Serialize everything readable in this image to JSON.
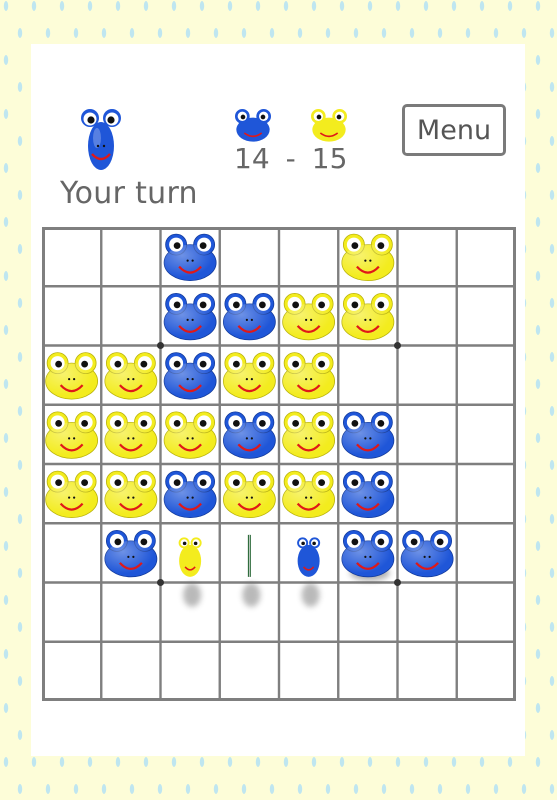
{
  "colors": {
    "background": "#fdfdd8",
    "raindrop": "#bfe6f0",
    "card": "#ffffff",
    "grid_line": "#7f7f7f",
    "blue_frog": "#1f56d8",
    "yellow_frog": "#f3ec1e",
    "text": "#666666"
  },
  "status": {
    "turn_label": "Your turn",
    "current_player": "blue"
  },
  "score": {
    "blue": "14",
    "separator": "-",
    "yellow": "15"
  },
  "menu": {
    "label": "Menu"
  },
  "board": {
    "rows": 8,
    "cols": 8,
    "legend": "B = blue frog, Y = yellow frog, . = empty",
    "cells": [
      ". . B . . Y . .",
      ". . B B Y Y . .",
      "Y Y B Y Y . . .",
      "Y Y Y B Y B . .",
      "Y Y B Y Y B . .",
      ". B . . . B B .",
      ". . . . . . . .",
      ". . . . . . . ."
    ],
    "flipping": [
      {
        "row": 5,
        "col": 2,
        "from": "yellow",
        "to": "blue",
        "stage": "yellow-edge"
      },
      {
        "row": 5,
        "col": 3,
        "from": "yellow",
        "to": "blue",
        "stage": "edge-on"
      },
      {
        "row": 5,
        "col": 4,
        "from": "yellow",
        "to": "blue",
        "stage": "blue-edge"
      }
    ],
    "last_move": {
      "row": 5,
      "col": 5,
      "color": "blue"
    }
  }
}
